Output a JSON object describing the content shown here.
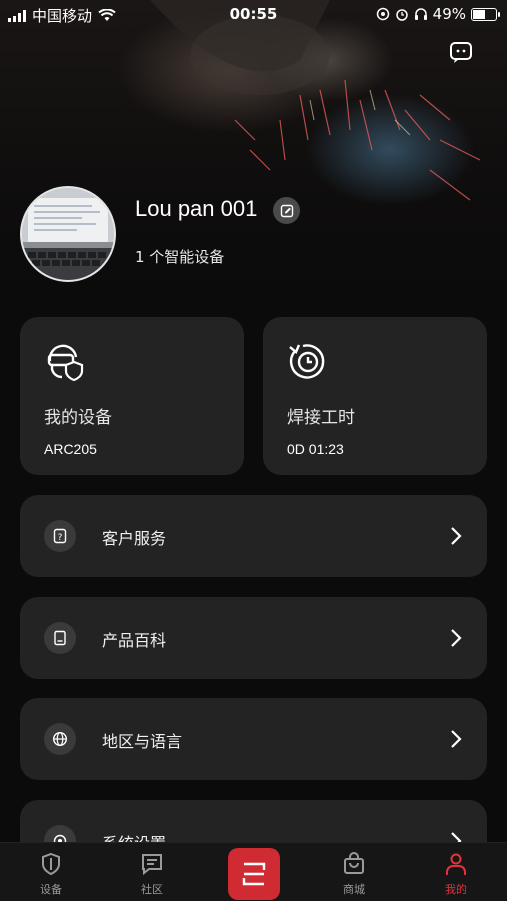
{
  "status_bar": {
    "carrier": "中国移动",
    "time": "00:55",
    "battery": "49%",
    "battery_level": 0.49
  },
  "profile": {
    "name": "Lou pan 001",
    "device_count": "1 个智能设备"
  },
  "cards": [
    {
      "title": "我的设备",
      "value": "ARC205",
      "icon": "helmet-shield-icon"
    },
    {
      "title": "焊接工时",
      "value": "0D 01:23",
      "icon": "clock-refresh-icon"
    }
  ],
  "menu": [
    {
      "label": "客户服务",
      "icon": "help-doc-icon"
    },
    {
      "label": "产品百科",
      "icon": "book-icon"
    },
    {
      "label": "地区与语言",
      "icon": "globe-icon"
    },
    {
      "label": "系统设置",
      "icon": "gear-icon"
    }
  ],
  "tabbar": {
    "items": [
      {
        "label": "设备",
        "icon": "shield-icon"
      },
      {
        "label": "社区",
        "icon": "chat-icon"
      },
      {
        "label": "商城",
        "icon": "shopping-bag-icon"
      },
      {
        "label": "我的",
        "icon": "person-icon"
      }
    ],
    "active": "我的",
    "accent": "#d02a33"
  }
}
